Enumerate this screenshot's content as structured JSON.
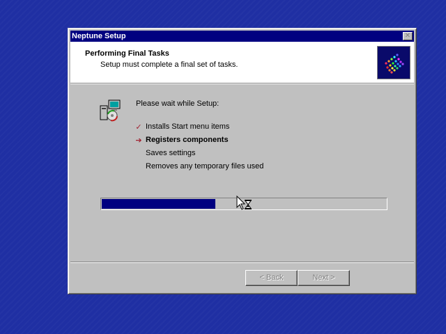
{
  "window": {
    "title": "Neptune Setup",
    "close_symbol": "✕"
  },
  "header": {
    "title": "Performing Final Tasks",
    "subtitle": "Setup must complete a final set of tasks."
  },
  "body": {
    "wait_text": "Please wait while Setup:",
    "tasks": [
      {
        "label": "Installs Start menu items",
        "status": "done",
        "marker": "✓"
      },
      {
        "label": "Registers components",
        "status": "current",
        "marker": "➔"
      },
      {
        "label": "Saves settings",
        "status": "pending",
        "marker": ""
      },
      {
        "label": "Removes any temporary files used",
        "status": "pending",
        "marker": ""
      }
    ],
    "progress_fraction": 0.4
  },
  "buttons": {
    "back_label": "< Back",
    "next_label": "Next >"
  },
  "icons": {
    "setup_icon": "setup-computer-icon",
    "logo": "neptune-logo",
    "cursor": "hourglass-cursor"
  },
  "colors": {
    "desktop": "#1f2fa3",
    "titlebar": "#000080",
    "progress": "#000080",
    "check": "#a02030",
    "arrow": "#a02030"
  }
}
